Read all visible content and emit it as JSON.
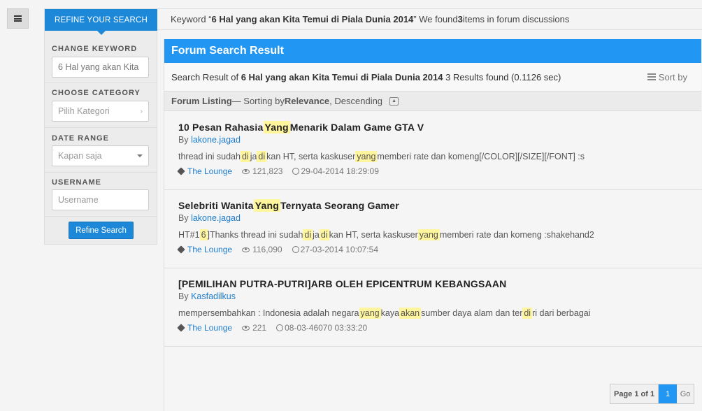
{
  "refine_tab": "REFINE YOUR SEARCH",
  "keyword_bar": {
    "prefix": "Keyword “",
    "keyword": "6 Hal yang akan Kita Temui di Piala Dunia 2014",
    "middle": "” We found ",
    "count": "3",
    "suffix": " items in forum discussions"
  },
  "filters": {
    "change_keyword_label": "CHANGE KEYWORD",
    "change_keyword_value": "6 Hal yang akan Kita",
    "category_label": "CHOOSE CATEGORY",
    "category_value": "Pilih Kategori",
    "date_label": "DATE RANGE",
    "date_value": "Kapan saja",
    "username_label": "USERNAME",
    "username_placeholder": "Username",
    "refine_button": "Refine Search"
  },
  "main": {
    "title": "Forum Search Result",
    "summary_prefix": "Search Result of ",
    "summary_keyword": "6 Hal yang akan Kita Temui di Piala Dunia 2014",
    "summary_suffix": " 3 Results found (0.1126 sec)",
    "sort_label": "Sort by",
    "listing_title": "Forum Listing",
    "listing_sep": " — Sorting by ",
    "listing_sort": "Relevance",
    "listing_order": ", Descending"
  },
  "results": [
    {
      "title_parts": [
        "10 Pesan Rahasia ",
        "Yang",
        " Menarik Dalam Game GTA V"
      ],
      "by_label": "By ",
      "author": "lakone.jagad",
      "snippet_parts": [
        "thread ini sudah ",
        "di",
        " ja ",
        "di",
        " kan HT, serta kaskuser ",
        "yang",
        " memberi rate dan komeng[/COLOR][/SIZE][/FONT] :s"
      ],
      "category": "The Lounge",
      "views": "121,823",
      "date": "29-04-2014 18:29:09"
    },
    {
      "title_parts": [
        "Selebriti Wanita ",
        "Yang",
        " Ternyata Seorang Gamer"
      ],
      "by_label": "By ",
      "author": "lakone.jagad",
      "snippet_parts": [
        "HT#1 ",
        "6",
        " ]Thanks thread ini sudah ",
        "di",
        " ja ",
        "di",
        " kan HT, serta kaskuser ",
        "yang",
        " memberi rate dan komeng :shakehand2"
      ],
      "category": "The Lounge",
      "views": "116,090",
      "date": "27-03-2014 10:07:54"
    },
    {
      "title_parts": [
        "[PEMILIHAN PUTRA-PUTRI]ARB OLEH EPICENTRUM KEBANGSAAN"
      ],
      "by_label": "By ",
      "author": "Kasfadilkus",
      "snippet_parts": [
        "mempersembahkan : Indonesia adalah negara ",
        "yang",
        " kaya ",
        "akan",
        " sumber daya alam dan ter ",
        "di",
        " ri dari berbagai"
      ],
      "category": "The Lounge",
      "views": "221",
      "date": "08-03-46070 03:33:20"
    }
  ],
  "pager": {
    "info": "Page 1 of 1",
    "current": "1",
    "go": "Go"
  }
}
